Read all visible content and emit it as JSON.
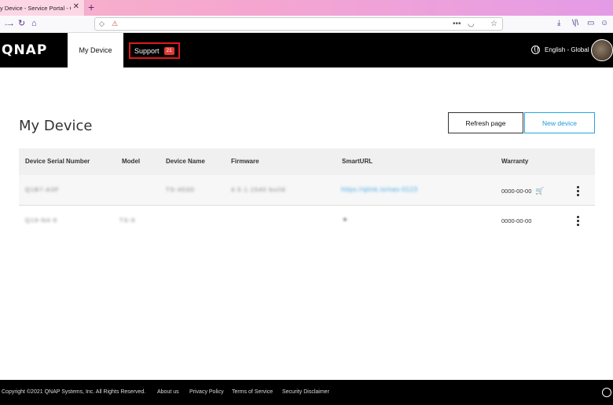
{
  "browser": {
    "tab_title": "y Device - Service Portal - Q",
    "tab_close": "✕",
    "new_tab": "+",
    "back": "←",
    "forward": "→",
    "reload": "↻",
    "home": "⌂",
    "url_more": "•••",
    "toolbar_download": "⤓",
    "toolbar_library": "\\|\\",
    "toolbar_sidebar": "▭",
    "toolbar_account": "☺"
  },
  "header": {
    "logo": "QNAP",
    "nav": {
      "my_device": "My Device",
      "support": "Support",
      "support_badge": "21"
    },
    "language": "English - Global"
  },
  "main": {
    "title": "My Device",
    "refresh_button": "Refresh page",
    "new_device_button": "New device",
    "columns": [
      "Device Serial Number",
      "Model",
      "Device Name",
      "Firmware",
      "SmartURL",
      "Warranty"
    ],
    "rows": [
      {
        "serial": "Q1B7-A3F",
        "model": "",
        "name": "TS-453D",
        "firmware": "4.5.1.1540 build",
        "smarturl": "https://qlink.to/nas-0123",
        "warranty": "0000-00-00"
      },
      {
        "serial": "Q19-N4-9",
        "model": "TS-9",
        "name": "",
        "firmware": "",
        "smarturl": "▪",
        "warranty": "0000-00-00"
      }
    ]
  },
  "footer": {
    "copyright": "Copyright ©2021 QNAP Systems, Inc. All Rights Reserved.",
    "about": "About us",
    "privacy": "Privacy Policy",
    "terms": "Terms of Service",
    "security": "Security Disclaimer"
  },
  "colors": {
    "accent": "#1a9ad9",
    "support_highlight": "#e0191e",
    "header_bg": "#000000"
  }
}
